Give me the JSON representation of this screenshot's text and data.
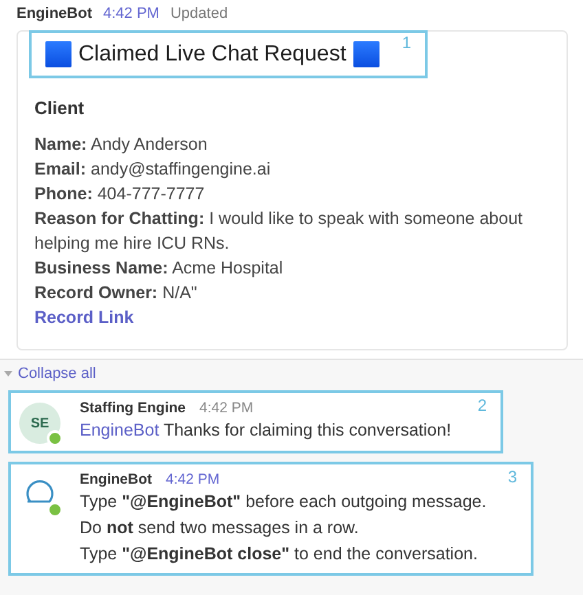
{
  "header": {
    "sender": "EngineBot",
    "time": "4:42 PM",
    "status": "Updated"
  },
  "card": {
    "title": "Claimed Live Chat Request",
    "callout": "1",
    "section": "Client",
    "fields": [
      {
        "label": "Name:",
        "value": "Andy Anderson"
      },
      {
        "label": "Email:",
        "value": "andy@staffingengine.ai"
      },
      {
        "label": "Phone:",
        "value": "404-777-7777"
      },
      {
        "label": "Reason for Chatting:",
        "value": "I would like to speak with someone about helping me hire ICU RNs."
      },
      {
        "label": "Business Name:",
        "value": "Acme Hospital"
      },
      {
        "label": "Record Owner:",
        "value": "N/A\""
      }
    ],
    "link": "Record Link"
  },
  "collapse": {
    "label": "Collapse all"
  },
  "replies": [
    {
      "avatar": {
        "kind": "initials",
        "text": "SE"
      },
      "online": true,
      "sender": "Staffing Engine",
      "time": "4:42 PM",
      "time_highlight": false,
      "callout": "2",
      "mention": "EngineBot",
      "lines": [
        "Thanks for claiming this conversation!"
      ]
    },
    {
      "avatar": {
        "kind": "bot"
      },
      "online": true,
      "sender": "EngineBot",
      "time": "4:42 PM",
      "time_highlight": true,
      "callout": "3",
      "lines": [
        "Type **\"@EngineBot\"** before each outgoing message.",
        "Do **not** send two messages in a row.",
        "Type **\"@EngineBot close\"** to end the conversation."
      ]
    }
  ]
}
